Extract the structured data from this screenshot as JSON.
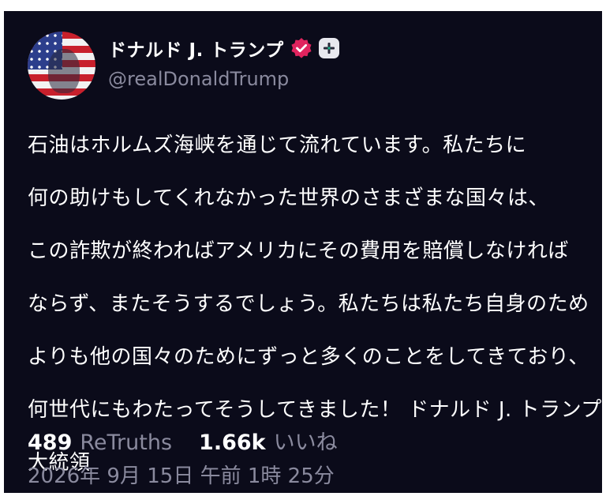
{
  "post": {
    "author": {
      "display_name": "ドナルド J. トランプ",
      "handle": "@realDonaldTrump",
      "verified_icon": "verified-badge-icon",
      "badge_color": "#e0245e"
    },
    "body_lines": [
      "石油はホルムズ海峡を通じて流れています。私たちに",
      "何の助けもしてくれなかった世界のさまざまな国々は、",
      "この詐欺が終わればアメリカにその費用を賠償しなければ",
      "ならず、またそうするでしょう。私たちは私たち自身のため",
      "よりも他の国々のためにずっと多くのことをしてきており、",
      "何世代にもわたってそうしてきました！ ドナルド J. トランプ",
      "大統領"
    ],
    "stats": {
      "retruths_count": "489",
      "retruths_label": "ReTruths",
      "likes_count": "1.66k",
      "likes_label": "いいね"
    },
    "timestamp": "2026年 9月 15日 午前 1時 25分"
  },
  "colors": {
    "background": "#0b0b1a",
    "muted_text": "#8a8a9e"
  }
}
